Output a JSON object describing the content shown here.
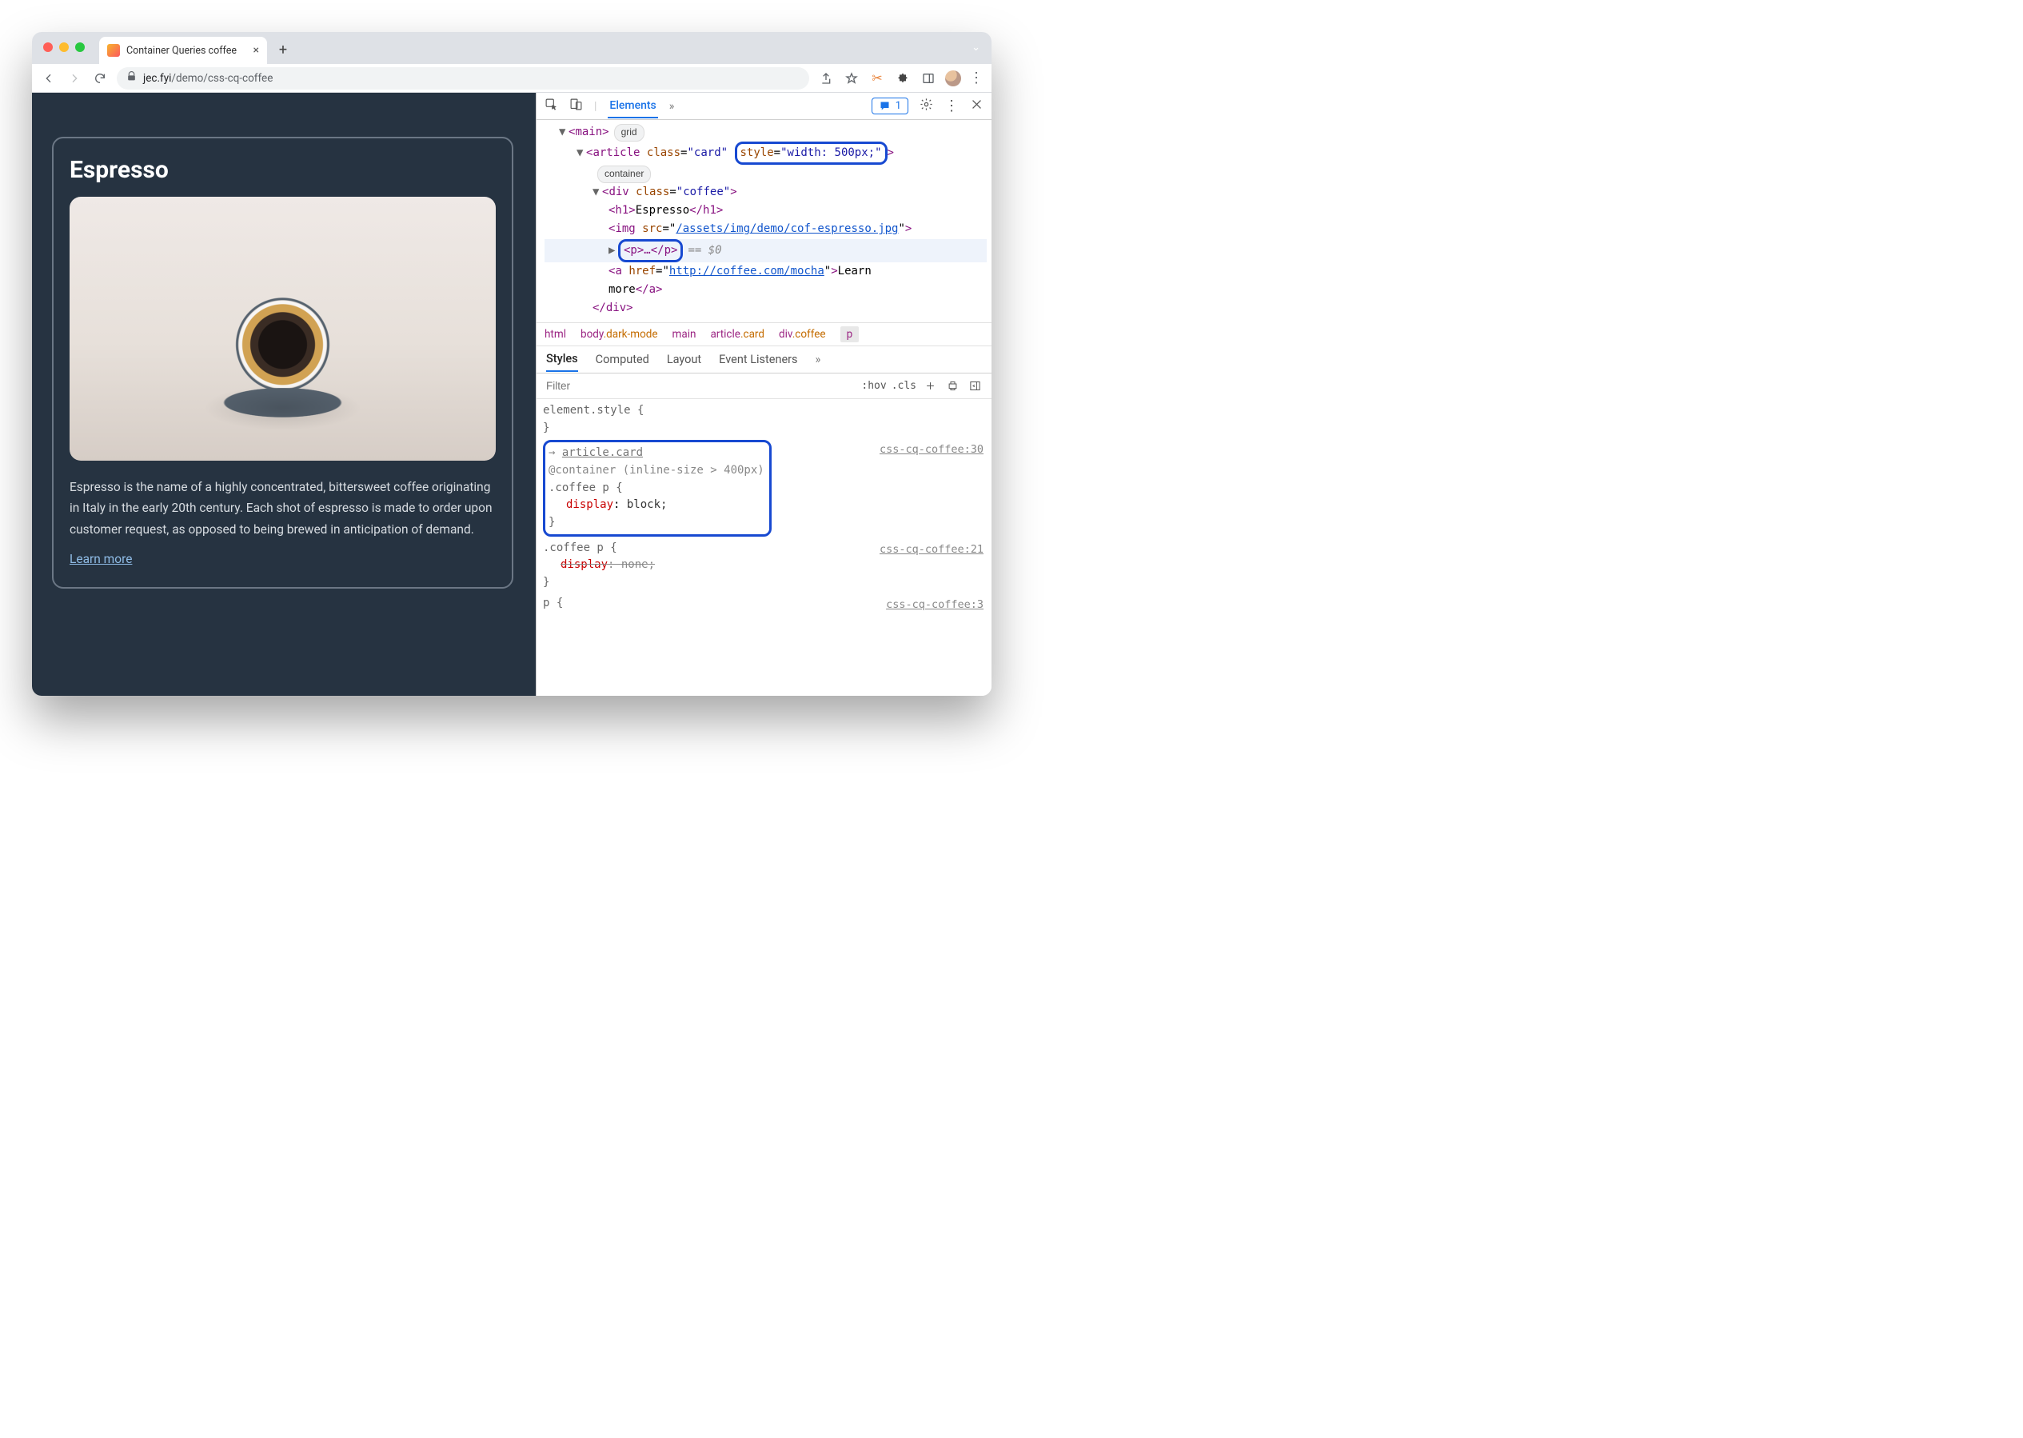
{
  "browser": {
    "tab_title": "Container Queries coffee",
    "url_host": "jec.fyi",
    "url_path": "/demo/css-cq-coffee"
  },
  "page": {
    "title": "Espresso",
    "body": "Espresso is the name of a highly concentrated, bittersweet coffee originating in Italy in the early 20th century. Each shot of espresso is made to order upon customer request, as opposed to being brewed in anticipation of demand.",
    "link_text": "Learn more"
  },
  "devtools": {
    "tabs": {
      "elements": "Elements"
    },
    "issues_count": "1",
    "styles_tabs": {
      "styles": "Styles",
      "computed": "Computed",
      "layout": "Layout",
      "event_listeners": "Event Listeners"
    },
    "filter_placeholder": "Filter",
    "hov": ":hov",
    "cls": ".cls"
  },
  "dom": {
    "main_open": "main",
    "grid_pill": "grid",
    "article": {
      "tag": "article",
      "class_attr": "class",
      "class_val": "\"card\"",
      "style_attr": "style",
      "style_val": "\"width: 500px;\""
    },
    "container_pill": "container",
    "div": {
      "tag": "div",
      "class_attr": "class",
      "class_val": "\"coffee\""
    },
    "h1_open": "<h1>",
    "h1_text": "Espresso",
    "h1_close": "</h1>",
    "img_tag": "img",
    "img_src_attr": "src",
    "img_src_val": "/assets/img/demo/cof-espresso.jpg",
    "p_collapsed": "<p>…</p>",
    "eq0": "== $0",
    "a_tag": "a",
    "a_href_attr": "href",
    "a_href_val": "http://coffee.com/mocha",
    "a_text1": "Learn ",
    "a_text2": "more",
    "a_close": "</a>",
    "div_close": "</div>"
  },
  "breadcrumb": {
    "b0": "html",
    "b1_a": "body",
    "b1_b": ".dark-mode",
    "b2": "main",
    "b3_a": "article",
    "b3_b": ".card",
    "b4_a": "div",
    "b4_b": ".coffee",
    "b5": "p"
  },
  "rules": {
    "r0": {
      "sel": "element.style {",
      "close": "}"
    },
    "r1": {
      "src": "css-cq-coffee:30",
      "arrow_link": "article.card",
      "cq": "@container (inline-size > 400px)",
      "sel": ".coffee p {",
      "prop": "display",
      "val": "block;",
      "close": "}"
    },
    "r2": {
      "src": "css-cq-coffee:21",
      "sel": ".coffee p {",
      "prop": "display",
      "val": "none;",
      "close": "}"
    },
    "r3": {
      "src": "css-cq-coffee:3",
      "sel": "p {"
    }
  }
}
